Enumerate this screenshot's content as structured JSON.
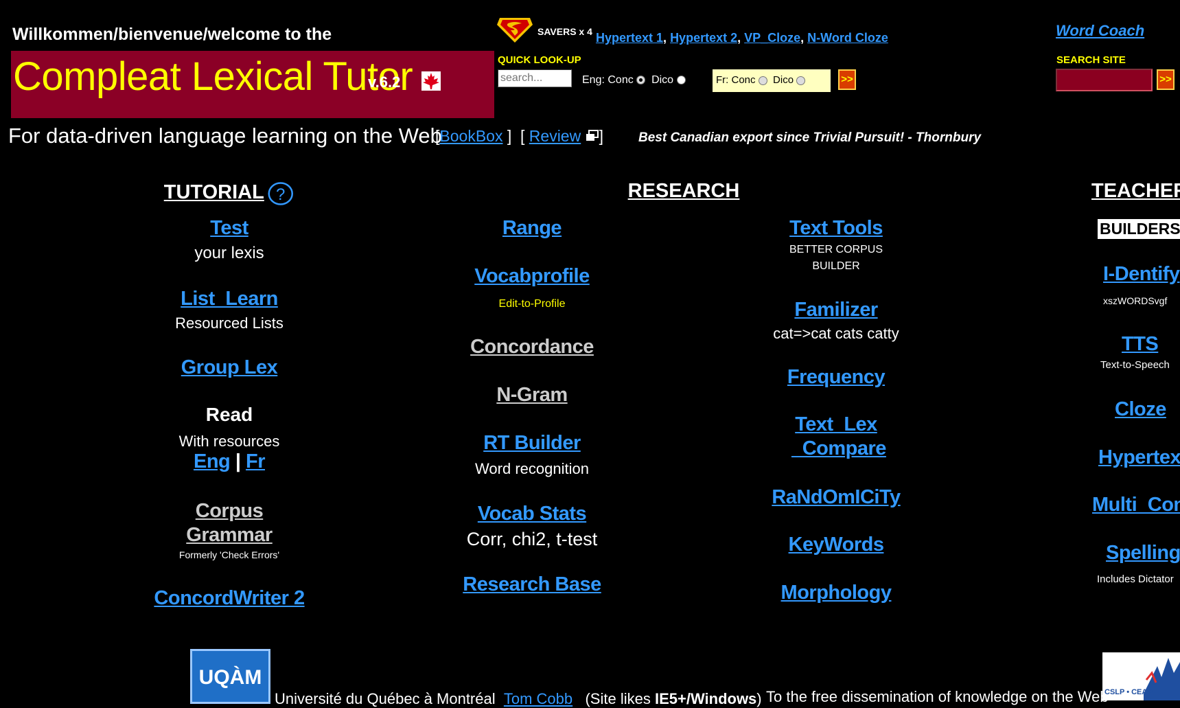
{
  "header": {
    "welcome": "Willkommen/bienvenue/welcome to the",
    "title": "Compleat Lexical Tutor",
    "version": "v.6.2",
    "tagline": "For data-driven language learning on the Web",
    "bookbox_link": "BookBox",
    "review_link": "Review",
    "quote": "Best Canadian export since Trivial Pursuit! - Thornbury",
    "maroon": "#8b0026",
    "yellow": "#ffff00"
  },
  "savers": {
    "label": "SAVERS x 4",
    "links": [
      "Hypertext 1",
      "Hypertext 2",
      "VP_Cloze",
      "N-Word Cloze"
    ],
    "icon": "superman-shield-icon"
  },
  "quick_lookup": {
    "label": "QUICK LOOK-UP",
    "placeholder": "search...",
    "eng_conc": "Eng: Conc",
    "eng_dico": "Dico",
    "fr_conc": "Fr: Conc",
    "fr_dico": "Dico",
    "go": ">>"
  },
  "site_search": {
    "word_coach": "Word Coach",
    "label": "SEARCH SITE",
    "go": ">>"
  },
  "tutorial": {
    "heading": "TUTORIAL",
    "help_icon": "?",
    "test": "Test",
    "test_sub": "your lexis",
    "list_learn": "List_Learn",
    "list_learn_sub": "Resourced Lists",
    "group_lex": "Group Lex",
    "read": "Read",
    "read_sub": "With resources",
    "eng": "Eng",
    "sep": "|",
    "fr": "Fr",
    "corpus": "Corpus",
    "grammar": "Grammar",
    "corpus_sub": "Formerly 'Check Errors'",
    "concordwriter": "ConcordWriter 2"
  },
  "research": {
    "heading": "RESEARCH",
    "range": "Range",
    "vocabprofile": "Vocabprofile",
    "edit_to_profile": "Edit-to-Profile",
    "concordance": "Concordance",
    "ngram": "N-Gram",
    "rt_builder": "RT Builder",
    "rt_sub": "Word recognition",
    "vocab_stats": "Vocab Stats",
    "vocab_stats_sub": "Corr, chi2, t-test",
    "research_base": "Research Base",
    "text_tools": "Text Tools",
    "text_tools_sub1": "BETTER CORPUS",
    "text_tools_sub2": "BUILDER",
    "familizer": "Familizer",
    "familizer_sub": "cat=>cat cats catty",
    "frequency": "Frequency",
    "text_lex": "Text_Lex",
    "compare": "_Compare",
    "randomicity": "RaNdOmICiTy",
    "keywords": "KeyWords",
    "morphology": "Morphology"
  },
  "teachers": {
    "heading": "TEACHERS",
    "builders": "BUILDERS ↓",
    "identify": "I-Dentify",
    "identify_sub": "xszWORDSvgf",
    "tts": "TTS",
    "tts_sub": "Text-to-Speech",
    "cloze": "Cloze",
    "hypertext": "Hypertext",
    "multi_conc": "Multi_Conc",
    "spelling": "Spelling",
    "spelling_sub": "Includes Dictator"
  },
  "footer": {
    "uqam": "UQÀM",
    "university": "Université du Québec à Montréal",
    "author": "Tom Cobb",
    "site_likes_pre": "(Site likes",
    "site_likes_bold": "IE5+/Windows",
    "site_likes_post": ")",
    "dissemination": "To the free dissemination of knowledge on the Web",
    "cslp": "CSLP • CEAP"
  }
}
